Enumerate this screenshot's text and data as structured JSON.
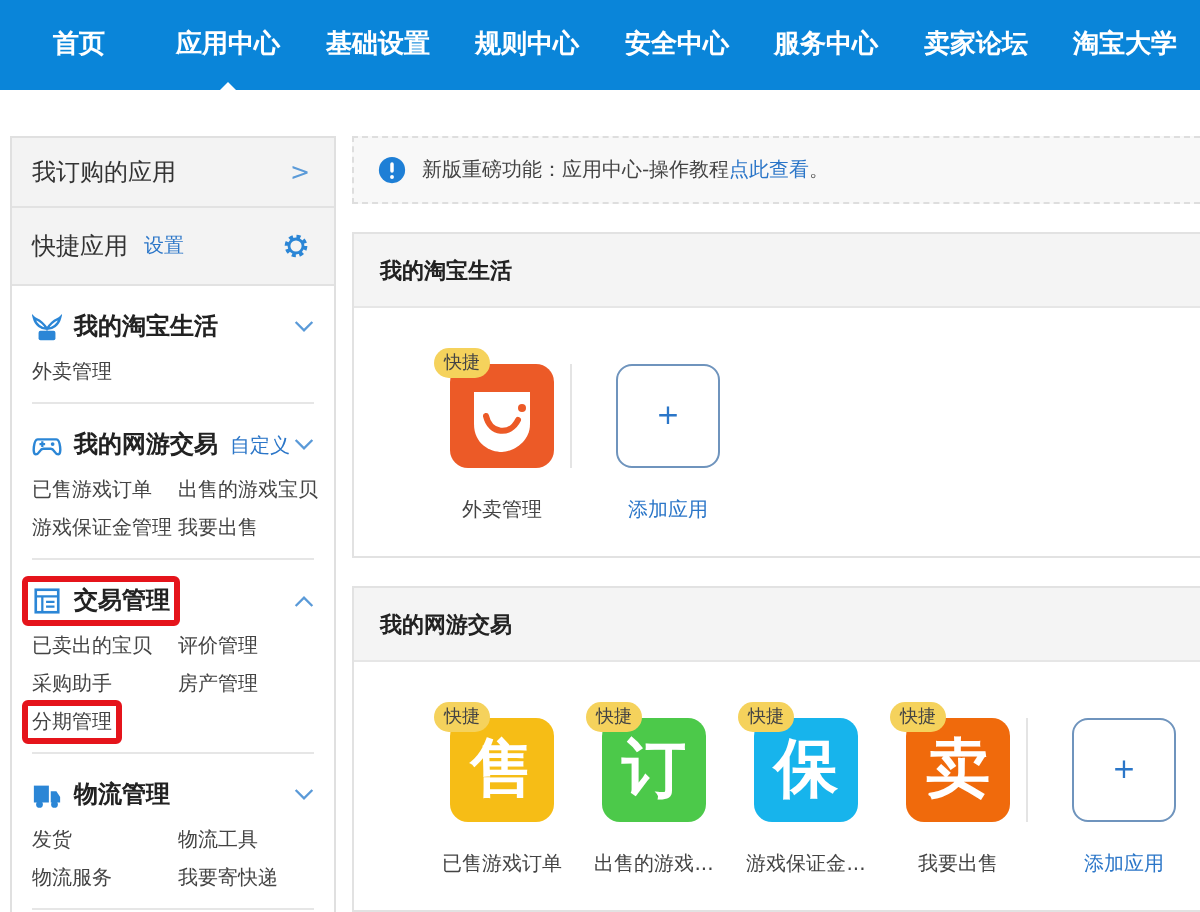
{
  "nav": {
    "items": [
      {
        "label": "首页",
        "selected": false
      },
      {
        "label": "应用中心",
        "selected": true
      },
      {
        "label": "基础设置",
        "selected": false
      },
      {
        "label": "规则中心",
        "selected": false
      },
      {
        "label": "安全中心",
        "selected": false
      },
      {
        "label": "服务中心",
        "selected": false
      },
      {
        "label": "卖家论坛",
        "selected": false
      },
      {
        "label": "淘宝大学",
        "selected": false
      }
    ]
  },
  "sidebar": {
    "subscribed": {
      "label": "我订购的应用",
      "arrow": ">"
    },
    "shortcuts": {
      "label": "快捷应用",
      "link": "设置"
    },
    "groups": [
      {
        "kind": "plant",
        "title": "我的淘宝生活",
        "expanded": false,
        "highlighted": false,
        "items": [
          {
            "label": "外卖管理",
            "highlighted": false
          }
        ]
      },
      {
        "kind": "gamepad",
        "title": "我的网游交易",
        "link": "自定义",
        "expanded": false,
        "highlighted": false,
        "items": [
          {
            "label": "已售游戏订单",
            "highlighted": false
          },
          {
            "label": "出售的游戏宝贝",
            "highlighted": false
          },
          {
            "label": "游戏保证金管理",
            "highlighted": false
          },
          {
            "label": "我要出售",
            "highlighted": false
          }
        ]
      },
      {
        "kind": "ledger",
        "title": "交易管理",
        "expanded": true,
        "highlighted": true,
        "items": [
          {
            "label": "已卖出的宝贝",
            "highlighted": false
          },
          {
            "label": "评价管理",
            "highlighted": false
          },
          {
            "label": "采购助手",
            "highlighted": false
          },
          {
            "label": "房产管理",
            "highlighted": false
          },
          {
            "label": "分期管理",
            "highlighted": true
          }
        ]
      },
      {
        "kind": "truck",
        "title": "物流管理",
        "expanded": false,
        "highlighted": false,
        "items": [
          {
            "label": "发货",
            "highlighted": false
          },
          {
            "label": "物流工具",
            "highlighted": false
          },
          {
            "label": "物流服务",
            "highlighted": false
          },
          {
            "label": "我要寄快递",
            "highlighted": false
          }
        ]
      }
    ]
  },
  "notice": {
    "text": "新版重磅功能：应用中心-操作教程",
    "link": "点此查看",
    "tail": "。"
  },
  "panels": [
    {
      "title": "我的淘宝生活",
      "apps": [
        {
          "kind": "smile",
          "color": "#ec5a27",
          "badge": "快捷",
          "label": "外卖管理"
        }
      ],
      "add": {
        "symbol": "+",
        "label": "添加应用"
      }
    },
    {
      "title": "我的网游交易",
      "apps": [
        {
          "kind": "glyph",
          "glyph": "售",
          "color": "#f6bd16",
          "badge": "快捷",
          "label": "已售游戏订单"
        },
        {
          "kind": "glyph",
          "glyph": "订",
          "color": "#4cc94a",
          "badge": "快捷",
          "label": "出售的游戏..."
        },
        {
          "kind": "glyph",
          "glyph": "保",
          "color": "#17b4ec",
          "badge": "快捷",
          "label": "游戏保证金..."
        },
        {
          "kind": "glyph",
          "glyph": "卖",
          "color": "#f06a0c",
          "badge": "快捷",
          "label": "我要出售"
        }
      ],
      "add": {
        "symbol": "+",
        "label": "添加应用"
      }
    }
  ]
}
